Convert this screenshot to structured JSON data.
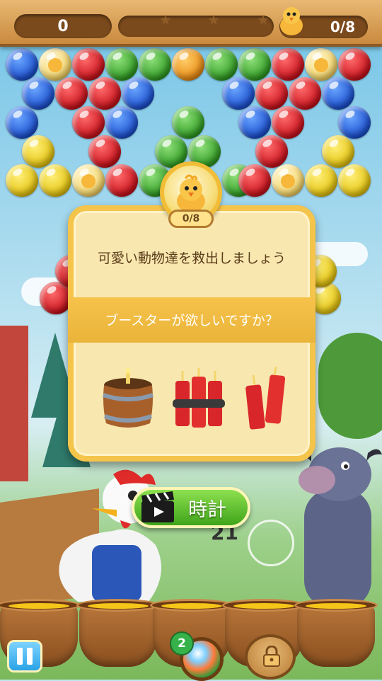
{
  "hud": {
    "score": "0",
    "rescued_progress": "0/8",
    "stars_earned": 0,
    "stars_total": 3
  },
  "modal": {
    "progress": "0/8",
    "title": "可愛い動物達を救出しましょう",
    "question": "ブースターが欲しいですか？",
    "boosters": [
      "barrel-bomb-icon",
      "dynamite-bundle-icon",
      "dynamite-pair-icon"
    ]
  },
  "watch_ad": {
    "label": "時計",
    "icon": "clapperboard-icon"
  },
  "play": {
    "timer": "21",
    "swap_count": "2"
  },
  "colors": {
    "hud_wood": "#c98a3e",
    "modal_bg": "#f9e7b0",
    "modal_border": "#f4c44b",
    "button_green": "#3fa41a",
    "pause_blue": "#2aa3e6"
  }
}
